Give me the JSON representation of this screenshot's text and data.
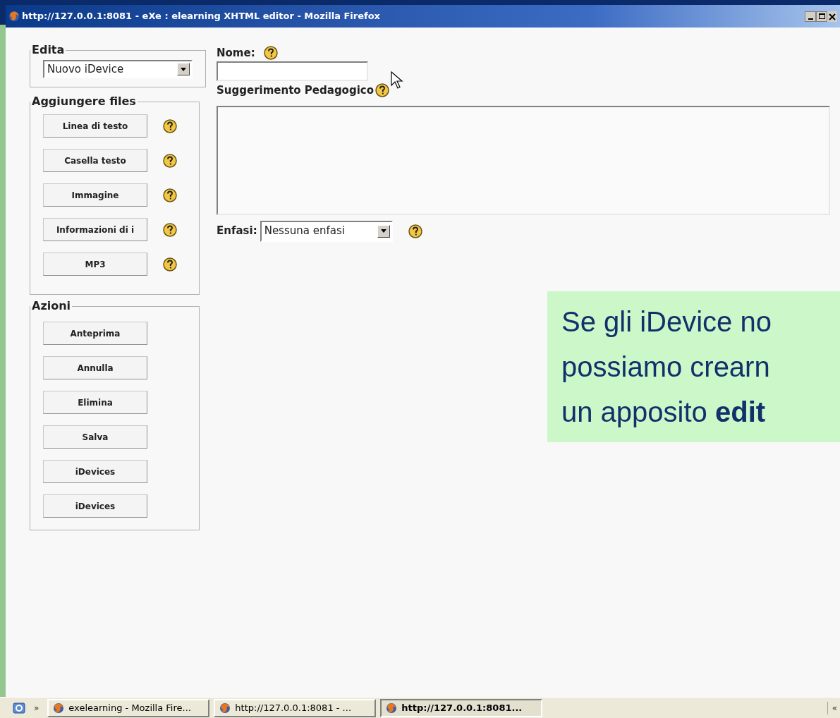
{
  "window": {
    "title": "http://127.0.0.1:8081 - eXe : elearning XHTML editor - Mozilla Firefox"
  },
  "sidebar": {
    "edit_group": {
      "legend": "Edita",
      "select_value": "Nuovo iDevice"
    },
    "add_group": {
      "legend": "Aggiungere files",
      "buttons": [
        {
          "label": "Linea di testo"
        },
        {
          "label": "Casella testo"
        },
        {
          "label": "Immagine"
        },
        {
          "label": "Informazioni di i"
        },
        {
          "label": "MP3"
        }
      ]
    },
    "actions_group": {
      "legend": "Azioni",
      "buttons": [
        {
          "label": "Anteprima"
        },
        {
          "label": "Annulla"
        },
        {
          "label": "Elimina"
        },
        {
          "label": "Salva"
        },
        {
          "label": "iDevices"
        },
        {
          "label": "iDevices"
        }
      ]
    }
  },
  "form": {
    "name_label": "Nome:",
    "hint_label": "Suggerimento Pedagogico",
    "emphasis_label": "Enfasi:",
    "emphasis_value": "Nessuna enfasi"
  },
  "callout": {
    "lines": [
      "Se gli iDevice no",
      "possiamo crearn",
      "un apposito **edit**"
    ]
  },
  "taskbar": {
    "expand": "»",
    "tasks": [
      {
        "label": "exelearning - Mozilla Fire...",
        "selected": false
      },
      {
        "label": "http://127.0.0.1:8081 - ...",
        "selected": false
      },
      {
        "label": "http://127.0.0.1:8081...",
        "selected": true
      }
    ],
    "tray": "«"
  }
}
